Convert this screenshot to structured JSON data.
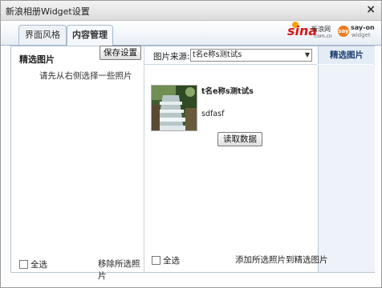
{
  "window": {
    "title": "新浪相册Widget设置",
    "close": "×"
  },
  "tabs": [
    {
      "label": "界面风格"
    },
    {
      "label": "内容管理"
    }
  ],
  "logos": {
    "sina": {
      "mark": "sina",
      "cn": "新浪网",
      "url": ".com.cn"
    },
    "sayon": {
      "badge": "say",
      "name": "say-on",
      "sub": "widget"
    }
  },
  "left_panel": {
    "title": "精选图片",
    "save_button": "保存设置",
    "hint": "请先从右侧选择一些照片",
    "select_all": "全选",
    "remove_link": "移除所选照片"
  },
  "right_panel": {
    "source_label": "图片来源:",
    "source_value": "t名e称s测t试s",
    "dropdown_arrow": "▼",
    "pick_tab": "精选图片",
    "album": {
      "title": "t名e称s测t试s",
      "description": "sdfasf"
    },
    "read_button": "读取数据",
    "select_all": "全选",
    "add_link": "添加所选照片到精选图片"
  },
  "colors": {
    "accent": "#1a3d6e",
    "sina_red": "#d7191b",
    "sayon_orange": "#ee7a1a",
    "panel_border": "#b9c6d6"
  }
}
